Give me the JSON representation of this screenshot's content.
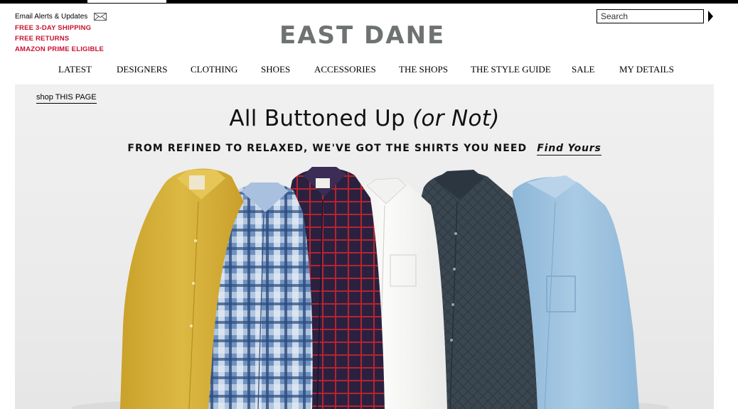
{
  "header": {
    "email_alerts": "Email Alerts & Updates",
    "promos": [
      "FREE 3-DAY SHIPPING",
      "FREE RETURNS",
      "AMAZON PRIME ELIGIBLE"
    ],
    "logo": "EAST DANE",
    "search": {
      "placeholder": "Search",
      "value": ""
    }
  },
  "nav": {
    "items": [
      "LATEST",
      "DESIGNERS",
      "CLOTHING",
      "SHOES",
      "ACCESSORIES",
      "THE SHOPS",
      "THE STYLE GUIDE",
      "SALE",
      "MY DETAILS"
    ]
  },
  "hero": {
    "shop_link": "shop THIS PAGE",
    "title": "All Buttoned Up",
    "title_italic": "(or Not)",
    "subtitle": "FROM REFINED TO RELAXED, WE'VE GOT THE SHIRTS YOU NEED",
    "cta": "Find Yours"
  },
  "colors": {
    "promo": "#c8102e",
    "logo": "#6e7372",
    "shirt_yellow": "#d7b13a",
    "shirt_blue_plaid": "#5c82b5",
    "shirt_red_check": "#2a2140",
    "shirt_white": "#f6f6f4",
    "shirt_charcoal": "#3a4650",
    "shirt_chambray": "#9fc3df"
  }
}
